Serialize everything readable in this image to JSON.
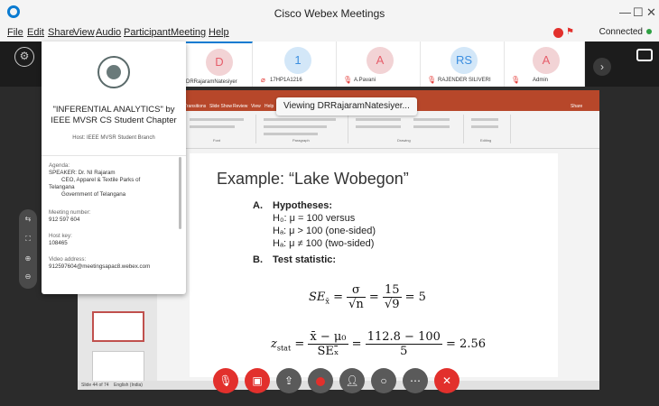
{
  "window": {
    "title": "Cisco Webex Meetings",
    "minimize": "—",
    "maximize": "☐",
    "close": "✕"
  },
  "menu": [
    "File",
    "Edit",
    "Share",
    "View",
    "Audio",
    "Participant",
    "Meeting",
    "Help"
  ],
  "status": {
    "connection": "Connected"
  },
  "participants": [
    {
      "initial": "D",
      "name": "DRRajaramNatesiyer",
      "color": "pink"
    },
    {
      "initial": "1",
      "name": "17HP1A1216",
      "color": "blue"
    },
    {
      "initial": "A",
      "name": "A.Pavani",
      "color": "pink"
    },
    {
      "initial": "RS",
      "name": "RAJENDER SILIVERI",
      "color": "blue"
    },
    {
      "initial": "A",
      "name": "Admin",
      "color": "pink"
    }
  ],
  "viewing": "Viewing DRRajaramNatesiyer...",
  "meeting_info": {
    "title": "\"INFERENTIAL ANALYTICS\" by IEEE MVSR CS Student Chapter",
    "host_label": "Host:",
    "host": "IEEE MVSR Student Branch",
    "agenda_label": "Agenda:",
    "agenda_lines": [
      "SPEAKER: Dr. NI Rajaram",
      "CEO, Apparel & Textile Parks of",
      "Telangana",
      "Government of Telangana"
    ],
    "meeting_number_label": "Meeting number:",
    "meeting_number": "912 597 604",
    "host_key_label": "Host key:",
    "host_key": "108465",
    "video_address_label": "Video address:",
    "video_address": "912597604@meetingsapac8.webex.com"
  },
  "slide": {
    "title": "Example: “Lake Wobegon”",
    "section_a": "A.",
    "hypotheses_label": "Hypotheses:",
    "h0": "H₀: μ = 100 versus",
    "ha1": "Hₐ: μ > 100 (one-sided)",
    "ha2": "Hₐ: μ ≠ 100 (two-sided)",
    "section_b": "B.",
    "test_statistic_label": "Test statistic:",
    "se_lhs": "SE",
    "se_sub": "x̄",
    "se_eq": "=",
    "sigma": "σ",
    "sqrt_n": "√n",
    "fifteen": "15",
    "sqrt9": "√9",
    "se_result": "= 5",
    "z_lhs": "z",
    "z_sub": "stat",
    "z_num": "x̄ − μ₀",
    "z_den": "SEₓ̄",
    "z_num2": "112.8 − 100",
    "z_den2": "5",
    "z_result": "= 2.56"
  },
  "ppt": {
    "tabs": [
      "Transitions",
      "Slide Show",
      "Review",
      "View",
      "Help"
    ],
    "title_bar": "Viewing DRRajaramNatesiyer",
    "groups": [
      "Font",
      "Paragraph",
      "Drawing",
      "Editing"
    ],
    "status_left": "Slide 44 of 74",
    "status_lang": "English (India)",
    "share": "Share"
  }
}
